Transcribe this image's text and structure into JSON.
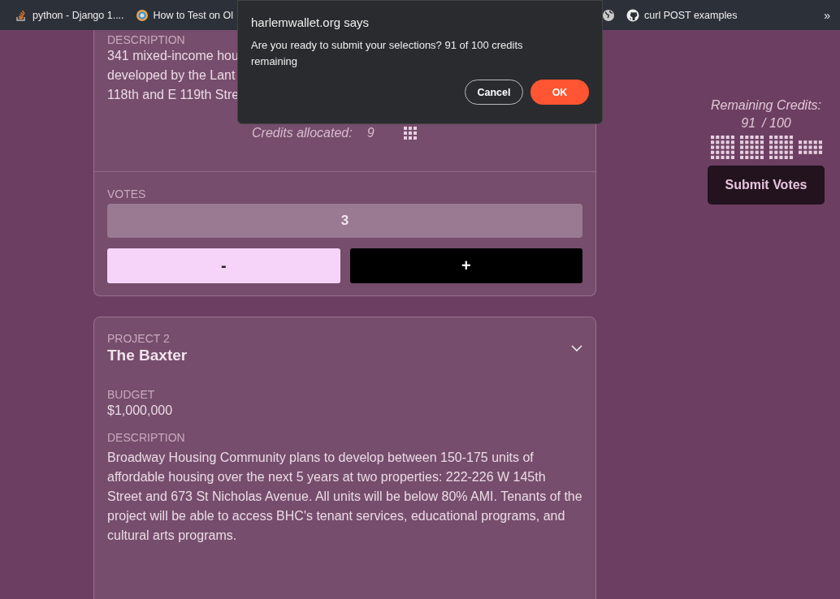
{
  "bookmarks": [
    {
      "kind": "stack",
      "label": "python - Django 1...."
    },
    {
      "kind": "ring",
      "label": "How to Test on Ol"
    },
    {
      "kind": "globe"
    },
    {
      "kind": "github",
      "label": "curl POST examples"
    }
  ],
  "bookmarks_more": "»",
  "dialog": {
    "title": "harlemwallet.org says",
    "message": "Are you ready to submit your selections? 91 of 100 credits remaining",
    "buttons": [
      {
        "label": "Cancel",
        "kind": "secondary"
      },
      {
        "label": "OK",
        "kind": "primary"
      }
    ]
  },
  "projects": [
    {
      "description_label": "DESCRIPTION",
      "description_lines": [
        "341 mixed-income hou",
        "developed by the Lant",
        "118th and E 119th Stre"
      ],
      "credits_label": "Credits allocated:",
      "credits": "9",
      "votes_label": "VOTES",
      "votes": "3",
      "minus": "-",
      "plus": "+"
    },
    {
      "number_label": "PROJECT 2",
      "title": "The Baxter",
      "budget_label": "BUDGET",
      "budget": "$1,000,000",
      "description_label": "DESCRIPTION",
      "description": "Broadway Housing Community plans to develop between 150-175 units of affordable housing over the next 5 years at two properties: 222-226 W 145th Street and 673 St Nicholas Avenue. All units will be below 80% AMI. Tenants of the project will be able to access BHC's tenant services, educational programs, and cultural arts programs."
    }
  ],
  "sidebar": {
    "label": "Remaining Credits:",
    "remaining": "91",
    "total": "/ 100",
    "button": "Submit Votes"
  }
}
